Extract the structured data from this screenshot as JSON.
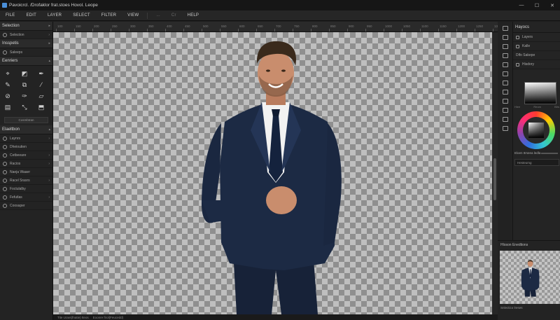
{
  "window": {
    "title": "Pavoicrcl. /Drofaklor frat.stoes Hovol. Leope",
    "controls": [
      "—",
      "☐",
      "✕"
    ]
  },
  "menu": [
    {
      "label": "FILE"
    },
    {
      "label": "EDIT"
    },
    {
      "label": "LAYER"
    },
    {
      "label": "SELECT"
    },
    {
      "label": "FILTER"
    },
    {
      "label": "VIEW"
    }
  ],
  "menu_dim": [
    "...",
    "Cr"
  ],
  "menu_help": "HELP",
  "left": {
    "selection_header": "Selection",
    "selection_item": "Selection",
    "inspector_header": "Insspetis",
    "layers_item": "Saleeps",
    "tools_header": "Eenriers",
    "tools": [
      "⌖",
      "◩",
      "✒",
      "✎",
      "⧉",
      "⁄",
      "⊘",
      "✑",
      "▱",
      "▤",
      "⤡",
      "⬒"
    ],
    "combine_btn": "Cosmbtran",
    "layers_header": "Elaeltbon",
    "layers": [
      "Laynrs",
      "Dheioutien",
      "Cetbeeare",
      "Racios",
      "Naeja Waaer",
      "Racel Srasrs",
      "Foctulalby",
      "Fefutlas",
      "Coosaper"
    ]
  },
  "ruler": [
    "100",
    "150",
    "200",
    "250",
    "300",
    "350",
    "400",
    "450",
    "500",
    "550",
    "600",
    "650",
    "700",
    "750",
    "800",
    "850",
    "900",
    "950",
    "1000",
    "1050",
    "1100",
    "1150",
    "1200",
    "1250",
    "1300"
  ],
  "status": {
    "left": "Tite Ucws(fnatie) Iteos",
    "right": "Eoonre firol(Feucedd)"
  },
  "right": {
    "header": "Hayocs",
    "rows": [
      "Layers",
      "Kalle",
      "Dlfo Sakepe"
    ],
    "history_label": "Hisdory",
    "picker_labels": [
      "Hlee",
      "Reom",
      "Blrs"
    ],
    "slider_label": "Eloen Itrseea ledla",
    "field_label": "Hesteumg"
  },
  "navigator": {
    "header": "Hloson Enedtions",
    "footer": "Snlectico lreses"
  },
  "colors": {
    "suit": "#1c2a44",
    "shirt": "#f2f2f2",
    "tie": "#14223d",
    "skin": "#c98d6d",
    "hair": "#3a2a1c",
    "accent": "#4a8fd8"
  }
}
